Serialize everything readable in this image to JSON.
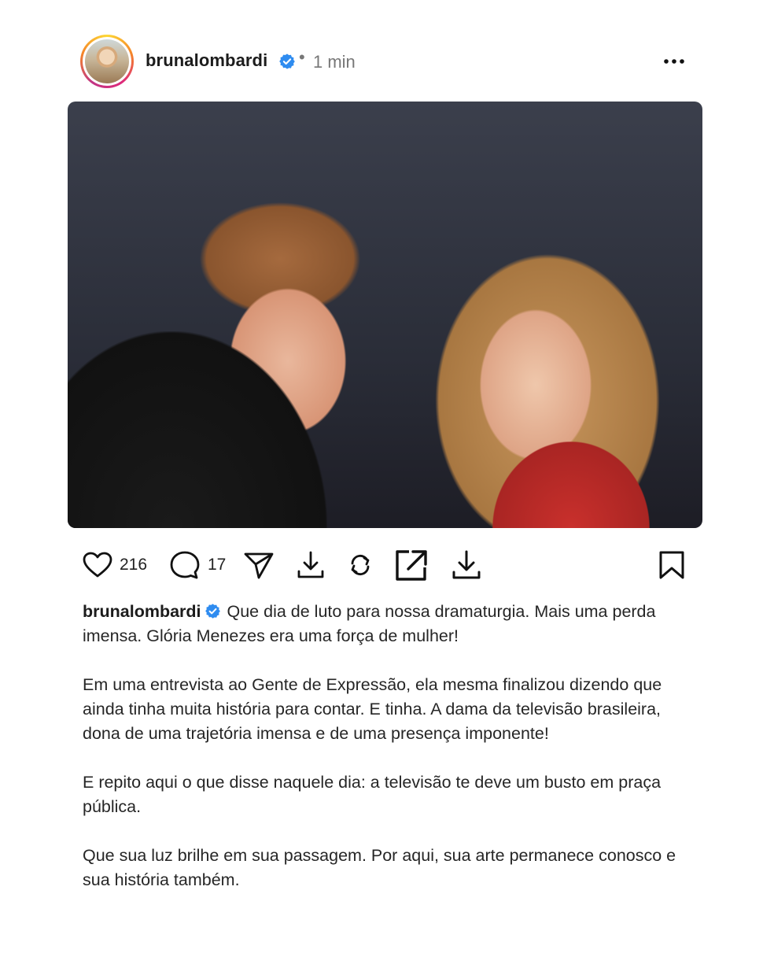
{
  "header": {
    "username": "brunalombardi",
    "separator": "•",
    "time": "1 min",
    "avatar_icon": "profile-photo",
    "more_icon": "more-horizontal-icon"
  },
  "post": {
    "image_icon": "post-photo"
  },
  "actions": {
    "likes": "216",
    "comments": "17"
  },
  "caption": {
    "username": "brunalombardi",
    "paragraphs": [
      "Que dia de luto para nossa dramaturgia. Mais uma perda imensa. Glória Menezes era uma força de mulher!",
      "Em uma entrevista ao Gente de Expressão, ela mesma finalizou dizendo que ainda tinha muita história para contar. E tinha. A dama da televisão brasileira, dona de uma trajetória imensa e de uma presença imponente!",
      "E repito aqui o que disse naquele dia: a televisão te deve um busto em praça pública.",
      "Que sua luz brilhe em sua passagem. Por aqui, sua arte permanece conosco e sua história também."
    ]
  },
  "colors": {
    "verified": "#2f8cf0",
    "text": "#262626",
    "muted": "#777777"
  }
}
